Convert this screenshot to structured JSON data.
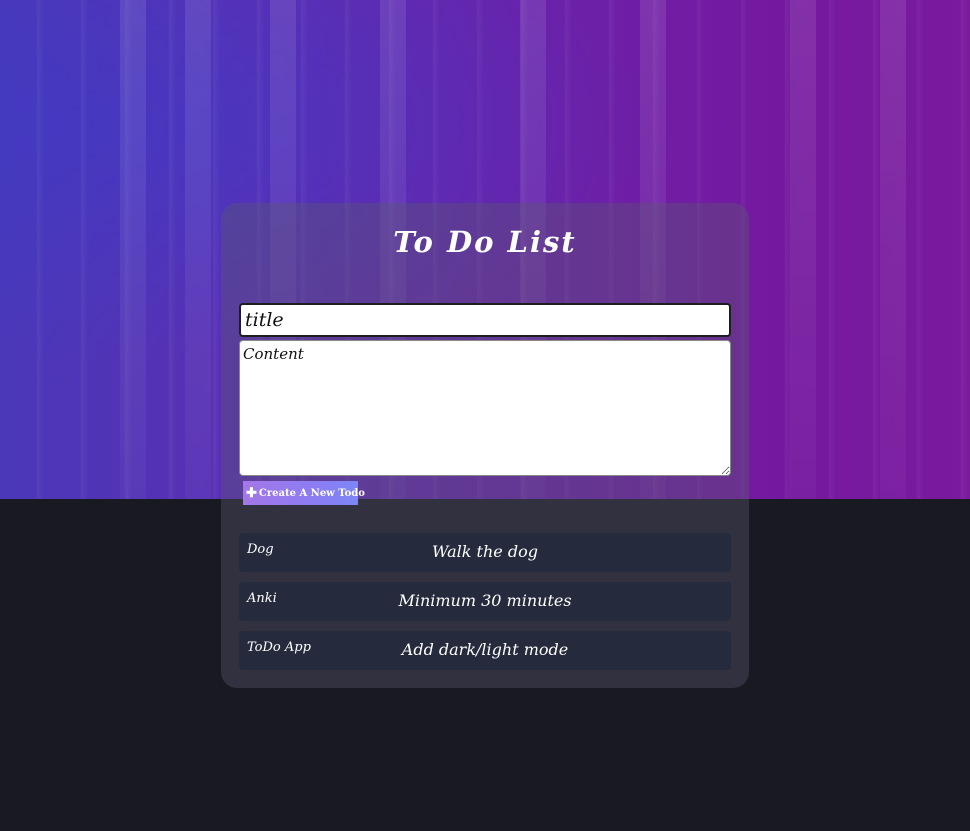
{
  "app": {
    "title": "To Do List"
  },
  "form": {
    "title_placeholder": "title",
    "title_value": "",
    "content_placeholder": "Content",
    "content_value": "",
    "create_label": "Create A New Todo",
    "create_icon": "plus-icon"
  },
  "todos": [
    {
      "title": "Dog",
      "content": "Walk the dog"
    },
    {
      "title": "Anki",
      "content": "Minimum 30 minutes"
    },
    {
      "title": "ToDo App",
      "content": "Add dark/light mode"
    }
  ],
  "colors": {
    "page_background": "#191922",
    "hero_purple": "#6a22aa",
    "todo_item_bg": "#252a3c",
    "button_gradient_start": "#a377e6",
    "button_gradient_end": "#7c86f6"
  }
}
